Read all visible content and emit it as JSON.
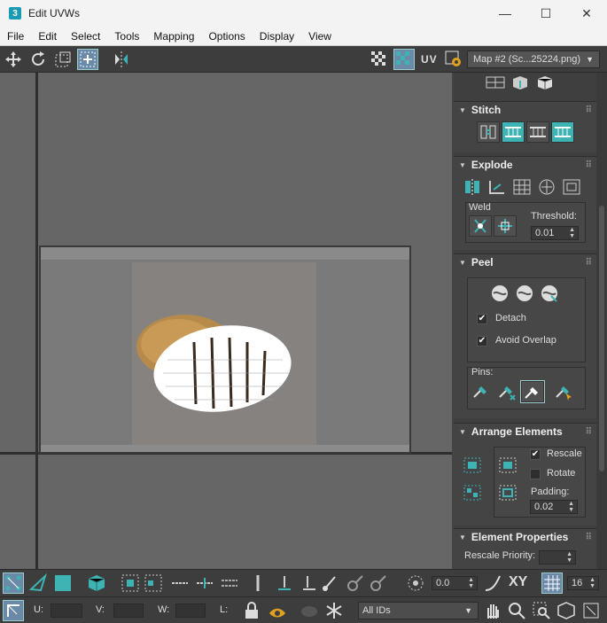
{
  "window": {
    "title": "Edit UVWs",
    "app_icon_text": "3"
  },
  "window_controls": {
    "minimize": "—",
    "maximize": "☐",
    "close": "✕"
  },
  "menu": [
    "File",
    "Edit",
    "Select",
    "Tools",
    "Mapping",
    "Options",
    "Display",
    "View"
  ],
  "toolbar": {
    "uv_label": "UV",
    "map_select": "Map #2 (Sc...25224.png)"
  },
  "panels": {
    "stitch": {
      "title": "Stitch"
    },
    "explode": {
      "title": "Explode",
      "weld_label": "Weld",
      "threshold_label": "Threshold:",
      "threshold_value": "0.01"
    },
    "peel": {
      "title": "Peel",
      "detach_label": "Detach",
      "detach_checked": true,
      "avoid_overlap_label": "Avoid Overlap",
      "avoid_overlap_checked": true,
      "pins_label": "Pins:"
    },
    "arrange": {
      "title": "Arrange Elements",
      "rescale_label": "Rescale",
      "rescale_checked": true,
      "rotate_label": "Rotate",
      "rotate_checked": false,
      "padding_label": "Padding:",
      "padding_value": "0.02"
    },
    "element_props": {
      "title": "Element Properties",
      "rescale_priority_label": "Rescale Priority:"
    }
  },
  "bottom": {
    "spinner_value": "0.0",
    "xy_label": "XY",
    "grid_value": "16",
    "u_label": "U:",
    "v_label": "V:",
    "w_label": "W:",
    "l_label": "L:",
    "ids_select": "All IDs"
  },
  "colors": {
    "accent": "#3db3b3",
    "selected": "#6a8aa8",
    "background": "#444444",
    "viewport": "#666666"
  }
}
